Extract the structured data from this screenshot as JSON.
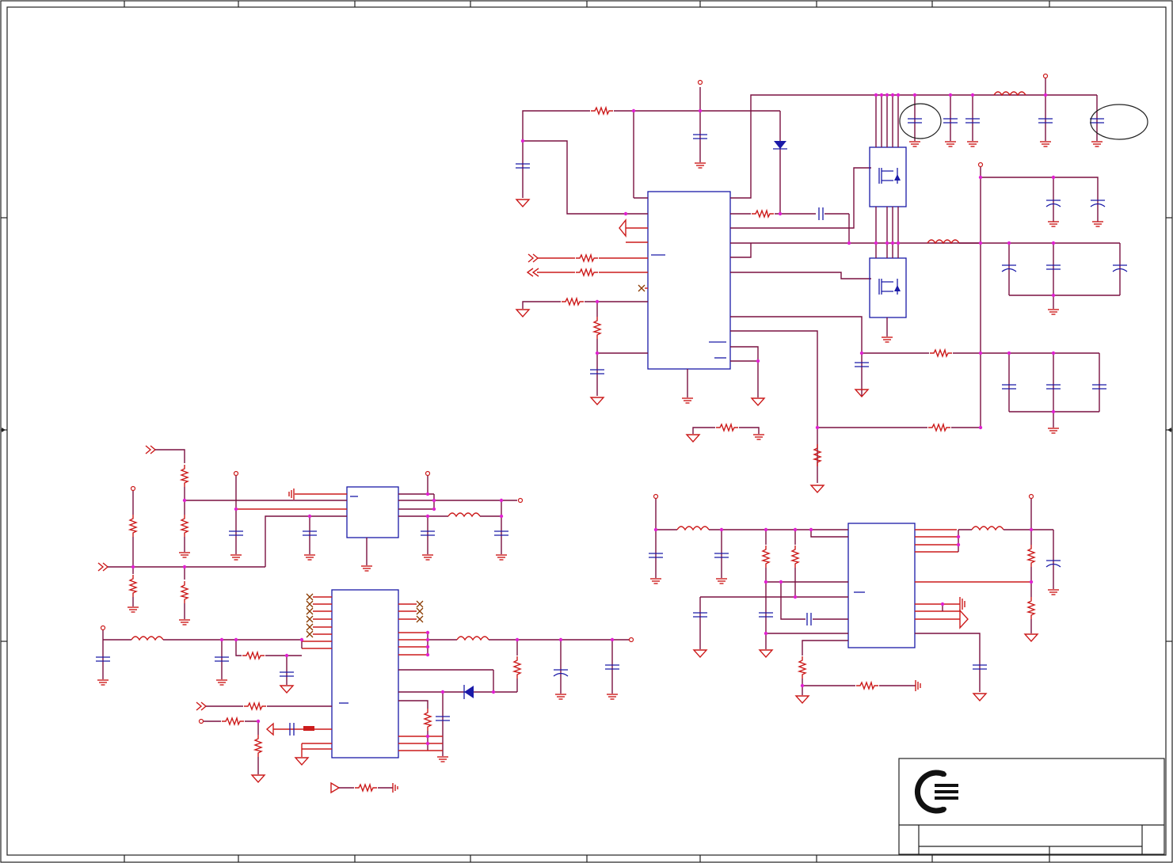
{
  "sheet": {
    "title_block": {
      "logo": "company-logo"
    }
  },
  "colors": {
    "wire": "#7a1040",
    "pin": "#cc1b1b",
    "component": "#1a1aa8",
    "junction": "#e020d0",
    "frame": "#222222"
  }
}
